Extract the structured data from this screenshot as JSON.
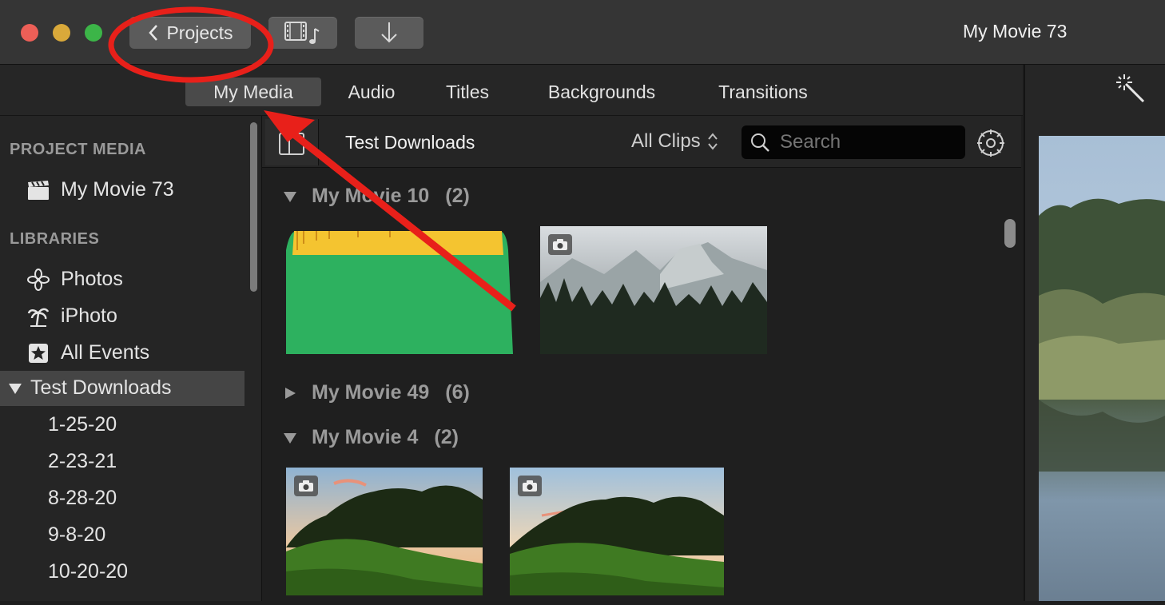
{
  "window": {
    "title": "My Movie 73"
  },
  "toolbar": {
    "projects_label": "Projects"
  },
  "tabs": [
    {
      "label": "My Media"
    },
    {
      "label": "Audio"
    },
    {
      "label": "Titles"
    },
    {
      "label": "Backgrounds"
    },
    {
      "label": "Transitions"
    }
  ],
  "sidebar": {
    "project_media_header": "PROJECT MEDIA",
    "project_item": "My Movie 73",
    "libraries_header": "LIBRARIES",
    "libraries": [
      {
        "label": "Photos",
        "icon": "photos-icon"
      },
      {
        "label": "iPhoto",
        "icon": "palm-tree-icon"
      },
      {
        "label": "All Events",
        "icon": "star-icon"
      }
    ],
    "selected_library": "Test Downloads",
    "events": [
      "1-25-20",
      "2-23-21",
      "8-28-20",
      "9-8-20",
      "10-20-20"
    ]
  },
  "browser": {
    "title": "Test Downloads",
    "filter": "All Clips",
    "search_placeholder": "Search",
    "groups": [
      {
        "name": "My Movie 10",
        "count": "(2)",
        "expanded": true
      },
      {
        "name": "My Movie 49",
        "count": "(6)",
        "expanded": false
      },
      {
        "name": "My Movie 4",
        "count": "(2)",
        "expanded": true
      }
    ]
  },
  "colors": {
    "annotation": "#e8201a",
    "audio_clip_green": "#2db15f",
    "audio_clip_yellow": "#f4c430"
  }
}
